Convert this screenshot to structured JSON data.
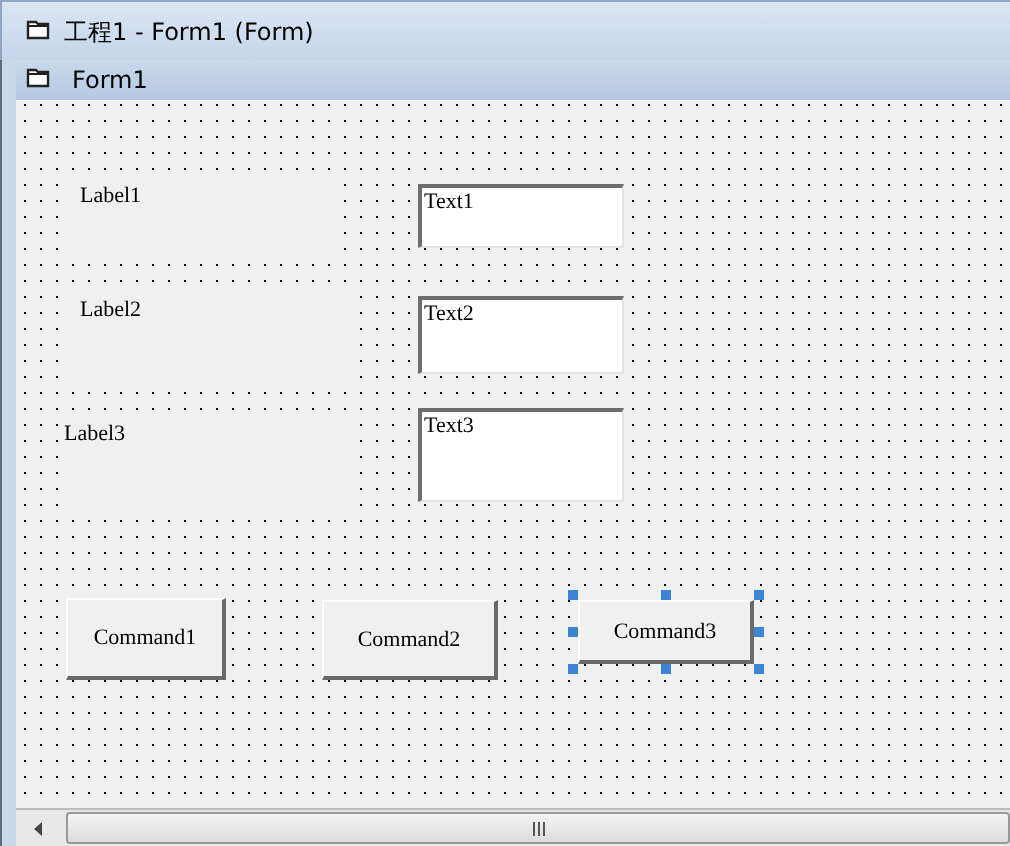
{
  "window": {
    "title": "工程1 - Form1 (Form)"
  },
  "form": {
    "title": "Form1",
    "controls": [
      {
        "kind": "label",
        "text": "Label1",
        "selected": false
      },
      {
        "kind": "label",
        "text": "Label2",
        "selected": false
      },
      {
        "kind": "label",
        "text": "Label3",
        "selected": false
      },
      {
        "kind": "textbox",
        "text": "Text1",
        "selected": false
      },
      {
        "kind": "textbox",
        "text": "Text2",
        "selected": false
      },
      {
        "kind": "textbox",
        "text": "Text3",
        "selected": false
      },
      {
        "kind": "command",
        "text": "Command1",
        "selected": false
      },
      {
        "kind": "command",
        "text": "Command2",
        "selected": false
      },
      {
        "kind": "command",
        "text": "Command3",
        "selected": true
      }
    ]
  }
}
